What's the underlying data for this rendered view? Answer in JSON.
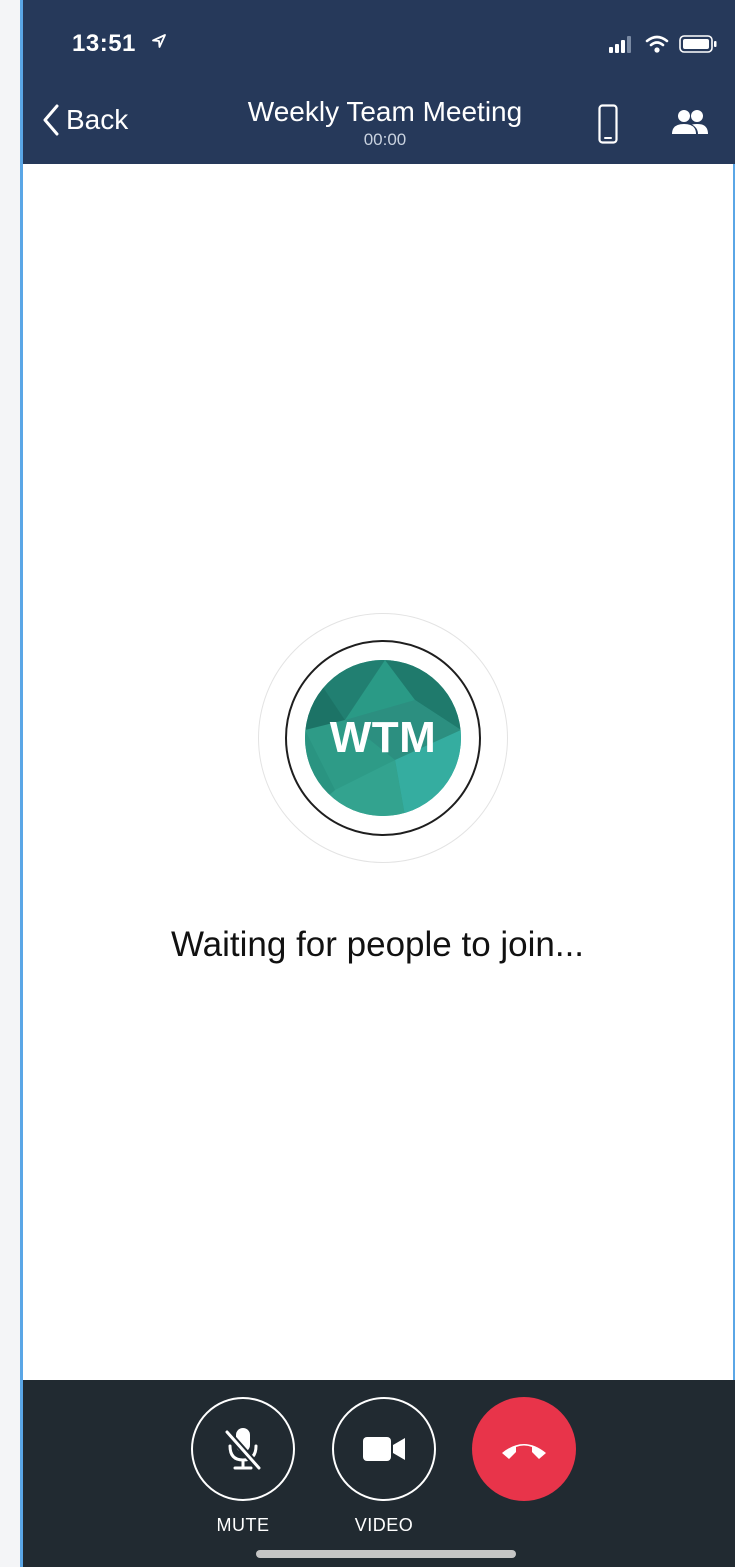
{
  "status_bar": {
    "time": "13:51",
    "location_icon": "location-arrow-icon",
    "signal_icon": "cellular-signal-icon",
    "wifi_icon": "wifi-icon",
    "battery_icon": "battery-icon"
  },
  "nav": {
    "back_label": "Back",
    "back_icon": "chevron-left-icon",
    "title": "Weekly Team Meeting",
    "timer": "00:00",
    "phone_icon": "mobile-device-icon",
    "participants_icon": "people-icon"
  },
  "meeting": {
    "avatar_initials": "WTM",
    "status_text": "Waiting for people to join..."
  },
  "controls": {
    "mute_label": "MUTE",
    "video_label": "VIDEO",
    "mute_icon": "microphone-off-icon",
    "video_icon": "video-camera-icon",
    "end_icon": "hang-up-icon"
  },
  "colors": {
    "header_bg": "#26395a",
    "avatar_green": "#2a9a86",
    "end_call_red": "#e8344a",
    "toolbar_bg": "#212a31"
  }
}
